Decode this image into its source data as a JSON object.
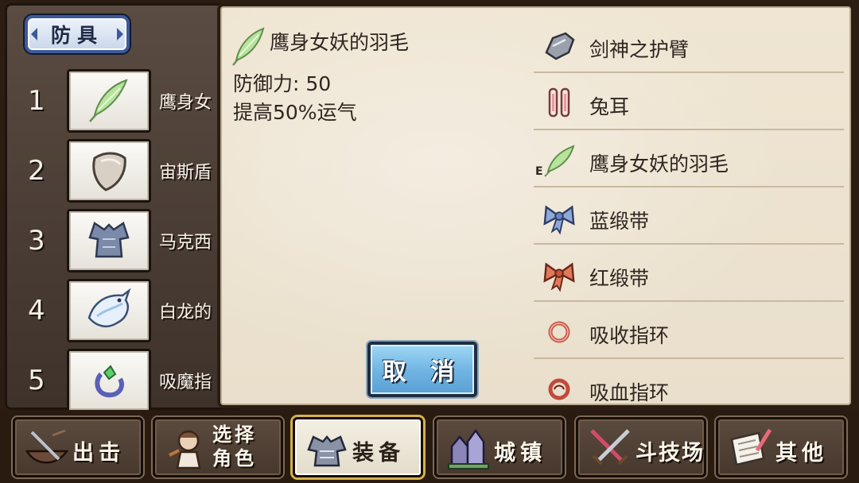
{
  "left_panel": {
    "category_tab": "防具",
    "rows": [
      {
        "num": "1",
        "name": "鹰身女",
        "icon": "feather-icon"
      },
      {
        "num": "2",
        "name": "宙斯盾",
        "icon": "shield-icon"
      },
      {
        "num": "3",
        "name": "马克西",
        "icon": "armor-icon"
      },
      {
        "num": "4",
        "name": "白龙的",
        "icon": "dragon-icon"
      },
      {
        "num": "5",
        "name": "吸魔指",
        "icon": "ring-icon"
      }
    ]
  },
  "detail": {
    "icon": "feather-icon",
    "title": "鹰身女妖的羽毛",
    "defense": "防御力: 50",
    "effect": "提高50%运气"
  },
  "cancel_label": "取 消",
  "equip_list": [
    {
      "label": "剑神之护臂",
      "icon": "gauntlet-icon"
    },
    {
      "label": "兔耳",
      "icon": "bunny-ears-icon"
    },
    {
      "label": "鹰身女妖的羽毛",
      "icon": "feather-icon",
      "mark": "E"
    },
    {
      "label": "蓝缎带",
      "icon": "blue-ribbon-icon"
    },
    {
      "label": "红缎带",
      "icon": "red-ribbon-icon"
    },
    {
      "label": "吸收指环",
      "icon": "ring-icon"
    },
    {
      "label": "吸血指环",
      "icon": "ring-icon"
    }
  ],
  "nav": [
    {
      "label": "出击",
      "icon": "sortie-icon"
    },
    {
      "label_line1": "选择",
      "label_line2": "角色",
      "icon": "character-icon"
    },
    {
      "label": "装备",
      "icon": "equipment-icon",
      "active": true
    },
    {
      "label": "城镇",
      "icon": "town-icon"
    },
    {
      "label": "斗技场",
      "icon": "arena-swords-icon"
    },
    {
      "label": "其他",
      "icon": "scroll-quill-icon"
    }
  ],
  "colors": {
    "cancel_button": "#6fb3e2",
    "tab_border": "#3d5a98",
    "active_nav_border": "#d6b24a"
  }
}
